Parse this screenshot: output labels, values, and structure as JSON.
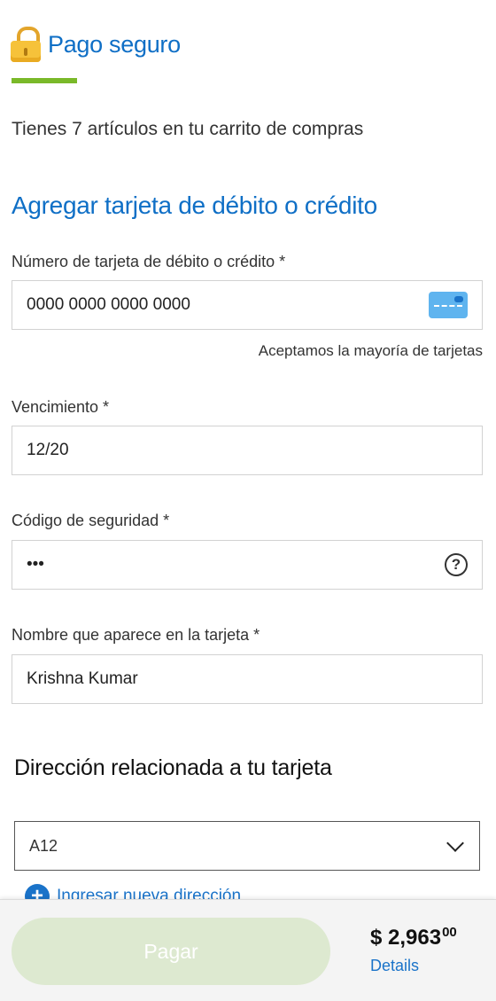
{
  "header": {
    "title": "Pago seguro",
    "icon": "lock-icon"
  },
  "cart_text": "Tienes 7 artículos en tu carrito de compras",
  "section_title": "Agregar tarjeta de débito o crédito",
  "card_number": {
    "label": "Número de tarjeta de débito o crédito *",
    "value": "0000 0000 0000 0000",
    "hint": "Aceptamos la mayoría de tarjetas"
  },
  "expiry": {
    "label": "Vencimiento *",
    "value": "12/20"
  },
  "security_code": {
    "label": "Código de seguridad *",
    "value": "•••",
    "help": "?"
  },
  "card_name": {
    "label": "Nombre que aparece en la tarjeta *",
    "value": "Krishna Kumar"
  },
  "address": {
    "title": "Dirección relacionada a tu tarjeta",
    "selected": "A12",
    "new_label": "Ingresar nueva dirección"
  },
  "footer": {
    "pay_label": "Pagar",
    "total_main": "$ 2,963",
    "total_cents": "00",
    "details_label": "Details"
  },
  "colors": {
    "accent": "#0f6fc6",
    "green_bar": "#7ab929",
    "pay_disabled": "#dde9d0"
  }
}
